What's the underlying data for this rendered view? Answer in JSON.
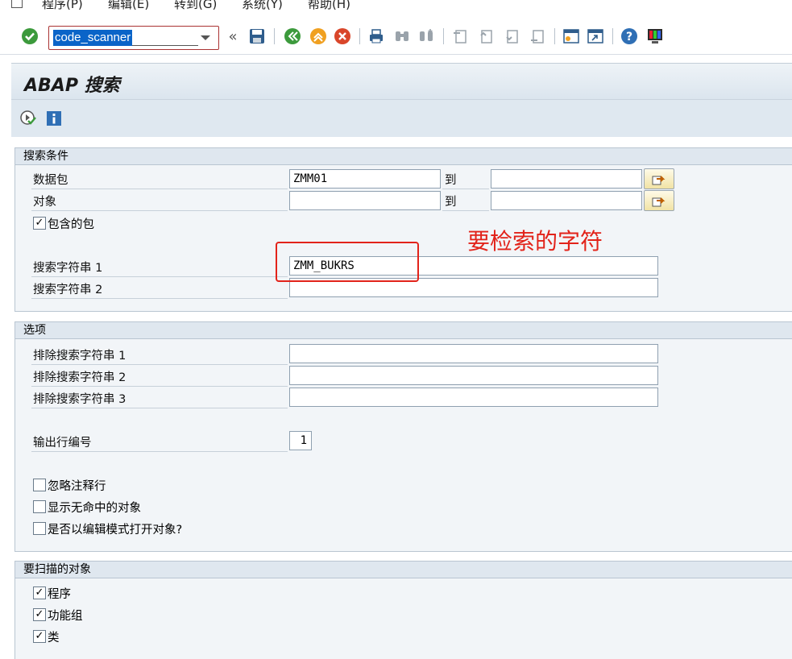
{
  "menu": {
    "items": [
      "程序(P)",
      "编辑(E)",
      "转到(G)",
      "系统(Y)",
      "帮助(H)"
    ]
  },
  "toolbar": {
    "command_value": "code_scanner",
    "double_arrow": "«"
  },
  "title": "ABAP 搜索",
  "search_criteria": {
    "header": "搜索条件",
    "package_label": "数据包",
    "package_value": "ZMM01",
    "to_label_1": "到",
    "object_label": "对象",
    "object_value": "",
    "to_label_2": "到",
    "include_pkg_label": "包含的包",
    "include_pkg_checked": "✓",
    "search_str1_label": "搜索字符串 1",
    "search_str1_value": "ZMM_BUKRS",
    "search_str2_label": "搜索字符串 2",
    "search_str2_value": ""
  },
  "annotation": {
    "text": "要检索的字符",
    "color": "#e2231a"
  },
  "options": {
    "header": "选项",
    "exclude1_label": "排除搜索字符串 1",
    "exclude2_label": "排除搜索字符串 2",
    "exclude3_label": "排除搜索字符串 3",
    "output_line_label": "输出行编号",
    "output_line_value": "1",
    "ignore_comments_label": "忽略注释行",
    "show_no_hits_label": "显示无命中的对象",
    "edit_mode_label": "是否以编辑模式打开对象?"
  },
  "scan_objects": {
    "header": "要扫描的对象",
    "program_label": "程序",
    "program_checked": "✓",
    "function_group_label": "功能组",
    "function_group_checked": "✓",
    "class_label": "类",
    "class_checked": "✓"
  },
  "colors": {
    "accent": "#0a64c8",
    "annotation": "#e2231a",
    "title_bg": "#dfe8f0"
  }
}
